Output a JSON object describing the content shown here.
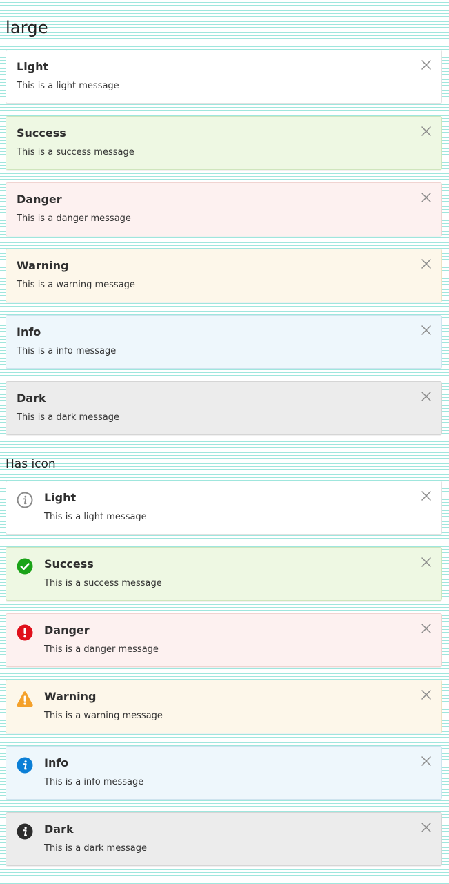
{
  "sections": {
    "large_title": "large",
    "icon_title": "Has icon"
  },
  "large_alerts": [
    {
      "variant": "light",
      "title": "Light",
      "message": "This is a light message"
    },
    {
      "variant": "success",
      "title": "Success",
      "message": "This is a success message"
    },
    {
      "variant": "danger",
      "title": "Danger",
      "message": "This is a danger message"
    },
    {
      "variant": "warning",
      "title": "Warning",
      "message": "This is a warning message"
    },
    {
      "variant": "info",
      "title": "Info",
      "message": "This is a info message"
    },
    {
      "variant": "dark",
      "title": "Dark",
      "message": "This is a dark message"
    }
  ],
  "icon_alerts": [
    {
      "variant": "light",
      "icon": "info-outline-icon",
      "title": "Light",
      "message": "This is a light message"
    },
    {
      "variant": "success",
      "icon": "check-circle-icon",
      "title": "Success",
      "message": "This is a success message"
    },
    {
      "variant": "danger",
      "icon": "exclamation-circle-icon",
      "title": "Danger",
      "message": "This is a danger message"
    },
    {
      "variant": "warning",
      "icon": "warning-triangle-icon",
      "title": "Warning",
      "message": "This is a warning message"
    },
    {
      "variant": "info",
      "icon": "info-circle-icon",
      "title": "Info",
      "message": "This is a info message"
    },
    {
      "variant": "dark",
      "icon": "info-circle-dark-icon",
      "title": "Dark",
      "message": "This is a dark message"
    }
  ],
  "colors": {
    "success_icon": "#1aa318",
    "danger_icon": "#e0101b",
    "warning_icon": "#f4a12b",
    "info_icon": "#0b7fd6",
    "dark_icon": "#2c2c2c",
    "light_icon": "#8a8a8a",
    "close_icon": "#8c8c8c",
    "stripe": "#9fe6dd"
  }
}
